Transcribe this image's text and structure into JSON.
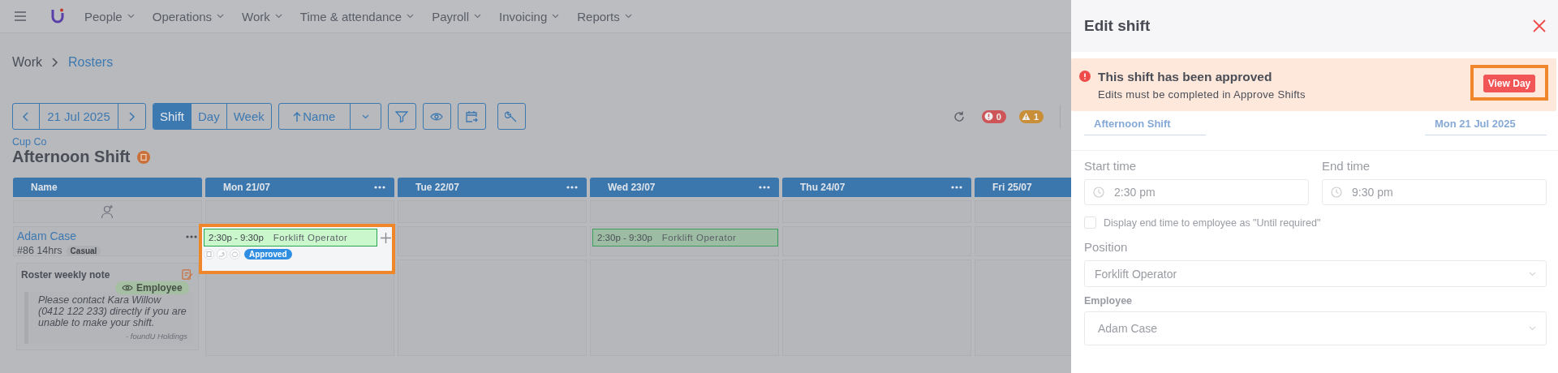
{
  "nav": {
    "items": [
      {
        "label": "People"
      },
      {
        "label": "Operations"
      },
      {
        "label": "Work"
      },
      {
        "label": "Time & attendance"
      },
      {
        "label": "Payroll"
      },
      {
        "label": "Invoicing"
      },
      {
        "label": "Reports"
      }
    ]
  },
  "breadcrumb": [
    {
      "label": "Work",
      "link": false
    },
    {
      "label": "Rosters",
      "link": true
    }
  ],
  "toolbar": {
    "date": "21 Jul 2025",
    "views": [
      {
        "label": "Shift",
        "selected": true
      },
      {
        "label": "Day",
        "selected": false
      },
      {
        "label": "Week",
        "selected": false
      }
    ],
    "sort": "Name",
    "error_count": "0",
    "warning_count": "1"
  },
  "company": "Cup Co",
  "roster_title": "Afternoon Shift",
  "grid": {
    "columns": [
      {
        "label": "Name",
        "menu": false
      },
      {
        "label": "Mon 21/07",
        "menu": true,
        "shift": {
          "time": "2:30p - 9:30p",
          "position": "Forklift Operator",
          "status": "Approved",
          "highlighted": true
        }
      },
      {
        "label": "Tue 22/07",
        "menu": true
      },
      {
        "label": "Wed 23/07",
        "menu": true,
        "shift": {
          "time": "2:30p - 9:30p",
          "position": "Forklift Operator",
          "highlighted": false
        }
      },
      {
        "label": "Thu 24/07",
        "menu": true
      },
      {
        "label": "Fri 25/07"
      }
    ],
    "employee": {
      "name": "Adam Case",
      "info": "#86 14hrs",
      "tag": "Casual"
    },
    "note": {
      "title": "Roster weekly note",
      "visibility": "Employee",
      "text": "Please contact Kara Willow (0412 122 233) directly if you are unable to make your shift.",
      "signature": "- foundU Holdings"
    }
  },
  "panel": {
    "title": "Edit shift",
    "alert": {
      "title": "This shift has been approved",
      "message": "Edits must be completed in Approve Shifts",
      "button": "View Day",
      "highlighted": true
    },
    "shift_name": "Afternoon Shift",
    "date": "Mon 21 Jul 2025",
    "start": {
      "label": "Start time",
      "value": "2:30 pm"
    },
    "end": {
      "label": "End time",
      "value": "9:30 pm"
    },
    "until_required": {
      "label": "Display end time to employee as \"Until required\"",
      "checked": false
    },
    "position": {
      "label": "Position",
      "value": "Forklift Operator"
    },
    "employee": {
      "label": "Employee",
      "value": "Adam Case"
    }
  }
}
